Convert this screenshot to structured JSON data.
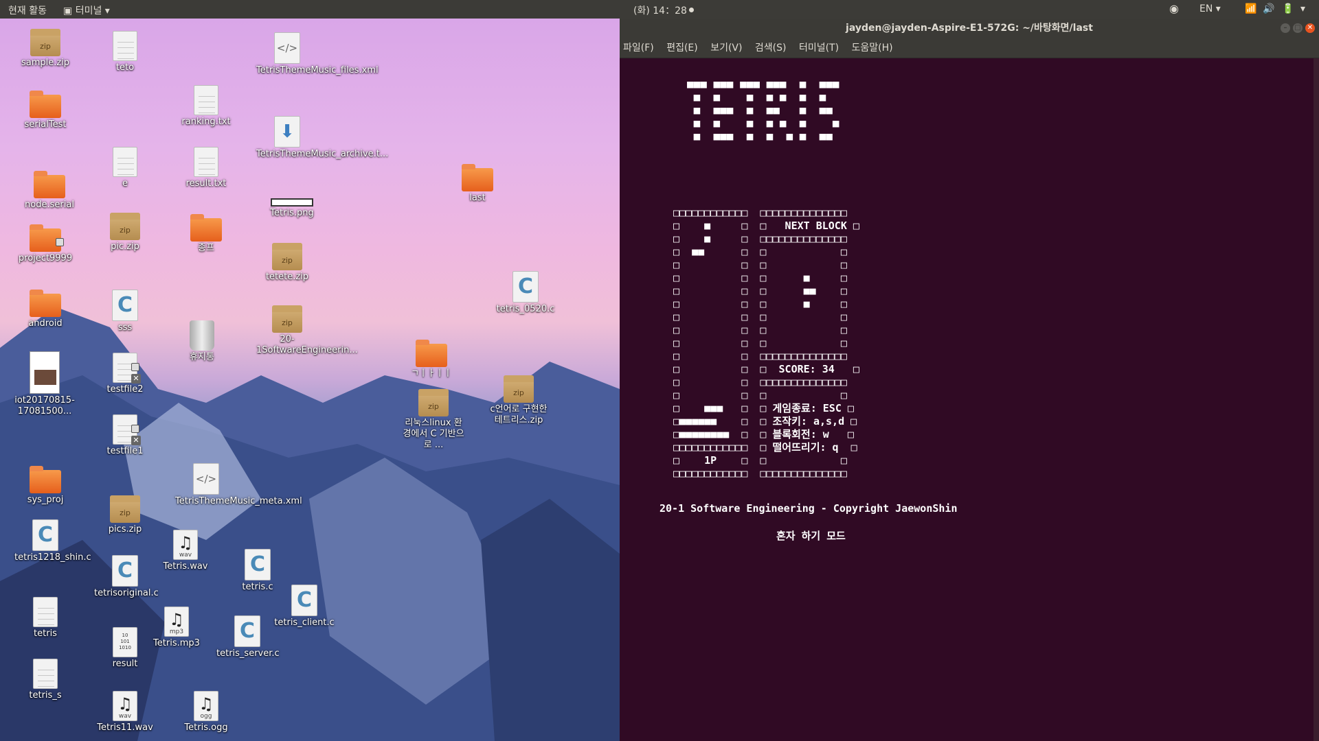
{
  "topbar": {
    "activities": "현재 활동",
    "app_menu": "터미널",
    "clock": "(화) 14：28",
    "lang": "EN"
  },
  "desktop_icons": [
    {
      "label": "sample.zip",
      "type": "zip"
    },
    {
      "label": "teto",
      "type": "doc"
    },
    {
      "label": "TetrisThemeMusic_files.xml",
      "type": "code"
    },
    {
      "label": "ranking.txt",
      "type": "doc"
    },
    {
      "label": "serialTest",
      "type": "folder"
    },
    {
      "label": "TetrisThemeMusic_archive.t...",
      "type": "download"
    },
    {
      "label": "e",
      "type": "doc"
    },
    {
      "label": "result.txt",
      "type": "doc"
    },
    {
      "label": "node.serial",
      "type": "folder"
    },
    {
      "label": "Tetris.png",
      "type": "image"
    },
    {
      "label": "last",
      "type": "folder"
    },
    {
      "label": "project9999",
      "type": "folder-locked"
    },
    {
      "label": "pic.zip",
      "type": "zip"
    },
    {
      "label": "종프",
      "type": "folder"
    },
    {
      "label": "tetete.zip",
      "type": "zip"
    },
    {
      "label": "android",
      "type": "folder"
    },
    {
      "label": "sss",
      "type": "c"
    },
    {
      "label": "휴지통",
      "type": "trash"
    },
    {
      "label": "20-1SoftwareEngineerin...",
      "type": "zip"
    },
    {
      "label": "tetris_0520.c",
      "type": "c"
    },
    {
      "label": "testfile2",
      "type": "doc-locked"
    },
    {
      "label": "ㄱㅣㅏㅣㅣ",
      "type": "folder"
    },
    {
      "label": "iot20170815-17081500...",
      "type": "pdf"
    },
    {
      "label": "리눅스linux 환경에서 C 기반으로 ...",
      "type": "zip"
    },
    {
      "label": "c언어로 구현한 테트리스.zip",
      "type": "zip"
    },
    {
      "label": "testfile1",
      "type": "doc-locked"
    },
    {
      "label": "sys_proj",
      "type": "folder"
    },
    {
      "label": "TetrisThemeMusic_meta.xml",
      "type": "code"
    },
    {
      "label": "pics.zip",
      "type": "zip"
    },
    {
      "label": "tetris1218_shin.c",
      "type": "c"
    },
    {
      "label": "Tetris.wav",
      "type": "wav"
    },
    {
      "label": "tetrisoriginal.c",
      "type": "c"
    },
    {
      "label": "tetris.c",
      "type": "c"
    },
    {
      "label": "tetris_client.c",
      "type": "c"
    },
    {
      "label": "tetris",
      "type": "doc"
    },
    {
      "label": "Tetris.mp3",
      "type": "mp3"
    },
    {
      "label": "tetris_server.c",
      "type": "c"
    },
    {
      "label": "result",
      "type": "binary"
    },
    {
      "label": "tetris_s",
      "type": "doc"
    },
    {
      "label": "Tetris11.wav",
      "type": "wav"
    },
    {
      "label": "Tetris.ogg",
      "type": "ogg"
    }
  ],
  "terminal": {
    "title": "jayden@jayden-Aspire-E1-572G: ~/바탕화면/last",
    "menu": [
      "파일(F)",
      "편집(E)",
      "보기(V)",
      "검색(S)",
      "터미널(T)",
      "도움말(H)"
    ],
    "logo_lines": [
      "■■■ ■■■ ■■■ ■■■  ■  ■■■",
      " ■  ■    ■  ■ ■  ■  ■  ",
      " ■  ■■■  ■  ■■   ■  ■■ ",
      " ■  ■    ■  ■ ■  ■    ■",
      " ■  ■■■  ■  ■  ■ ■  ■■ "
    ],
    "screen_lines": [
      "□□□□□□□□□□□□  □□□□□□□□□□□□□□",
      "□    ■     □  □   NEXT BLOCK □",
      "□    ■     □  □□□□□□□□□□□□□□",
      "□  ■■      □  □            □",
      "□          □  □            □",
      "□          □  □      ■     □",
      "□          □  □      ■■    □",
      "□          □  □      ■     □",
      "□          □  □            □",
      "□          □  □            □",
      "□          □  □            □",
      "□          □  □□□□□□□□□□□□□□",
      "□          □  □  SCORE: 34   □",
      "□          □  □□□□□□□□□□□□□□",
      "□          □  □            □",
      "□    ■■■   □  □ 게임종료: ESC □",
      "□■■■■■■    □  □ 조작키: a,s,d □",
      "□■■■■■■■■  □  □ 블록회전: w   □",
      "□□□□□□□□□□□□  □ 떨어뜨리기: q  □",
      "□    1P    □  □            □",
      "□□□□□□□□□□□□  □□□□□□□□□□□□□□"
    ],
    "footer": "20-1 Software Engineering - Copyright JaewonShin",
    "mode": "혼자 하기 모드"
  }
}
